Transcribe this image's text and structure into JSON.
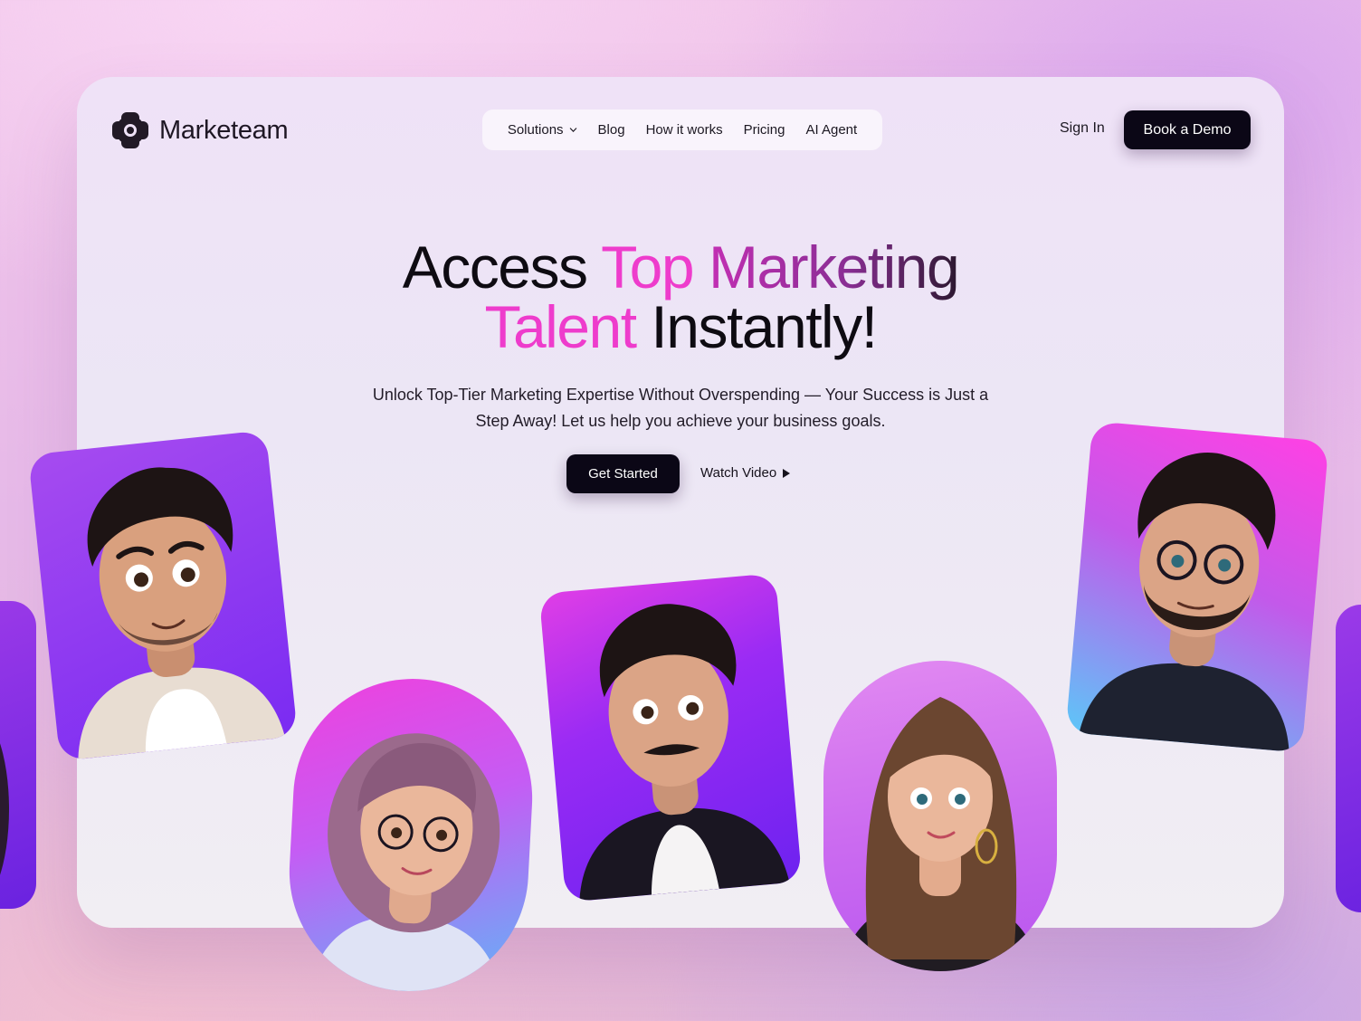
{
  "brand": {
    "name": "Marketeam",
    "accent_pink": "#ee3ccc",
    "dark": "#0b0716"
  },
  "nav": {
    "items": [
      {
        "label": "Solutions",
        "has_dropdown": true
      },
      {
        "label": "Blog"
      },
      {
        "label": "How it works"
      },
      {
        "label": "Pricing"
      },
      {
        "label": "AI Agent"
      }
    ]
  },
  "header": {
    "sign_in": "Sign In",
    "book_demo": "Book a Demo"
  },
  "hero": {
    "headline_part1": "Access",
    "headline_part2": "Top",
    "headline_part3": "Marketing",
    "headline_part4": "Talent",
    "headline_part5": "Instantly!",
    "subtext": "Unlock Top-Tier Marketing Expertise Without Overspending — Your Success is Just a Step Away! Let us help you achieve your business goals.",
    "cta_primary": "Get Started",
    "cta_secondary": "Watch Video"
  },
  "avatars": [
    {
      "icon": "avatar-man-curly-hoodie"
    },
    {
      "icon": "avatar-woman-glasses"
    },
    {
      "icon": "avatar-man-mustache"
    },
    {
      "icon": "avatar-woman-long-hair"
    },
    {
      "icon": "avatar-man-glasses-beard"
    }
  ]
}
